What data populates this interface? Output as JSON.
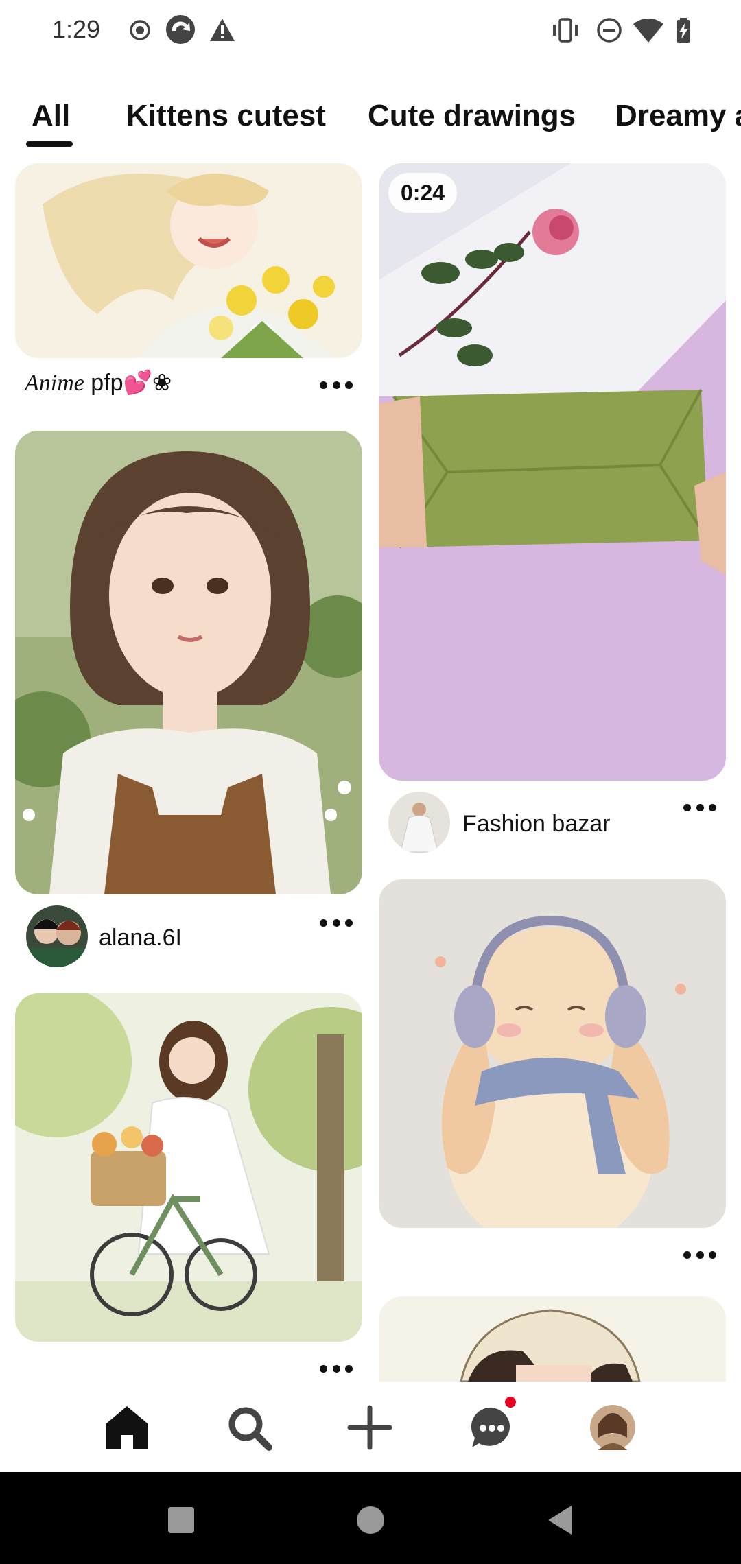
{
  "status_bar": {
    "time": "1:29",
    "left_icons": [
      "record-icon",
      "sync-app-icon",
      "warning-icon"
    ],
    "right_icons": [
      "vibrate-icon",
      "do-not-disturb-icon",
      "wifi-icon",
      "battery-charging-icon"
    ]
  },
  "tabs": [
    {
      "label": "All",
      "selected": true
    },
    {
      "label": "Kittens cutest",
      "selected": false
    },
    {
      "label": "Cute drawings",
      "selected": false
    },
    {
      "label": "Dreamy a",
      "selected": false
    }
  ],
  "feed": {
    "left_column": [
      {
        "image": "anime girl with yellow tulips",
        "caption_italic": "Anime",
        "caption_rest": " pfp💕❀",
        "has_more": true
      },
      {
        "image": "girl with bob haircut in garden",
        "author": "alana.6I",
        "has_more": true
      },
      {
        "image": "girl riding bicycle in forest",
        "has_more": true
      }
    ],
    "right_column": [
      {
        "image": "folding green paper envelope with rose",
        "video_duration": "0:24",
        "author": "Fashion bazar",
        "has_more": true
      },
      {
        "image": "bunny with headphones and scarf",
        "has_more": true
      },
      {
        "image": "drawing of girl with hat",
        "has_more": false
      }
    ]
  },
  "bottom_nav": {
    "items": [
      "home-icon",
      "search-icon",
      "create-icon",
      "messages-icon",
      "profile-avatar"
    ],
    "active": "home-icon",
    "messages_has_notification": true
  },
  "colors": {
    "accent_red": "#e60023",
    "text": "#111111",
    "background": "#ffffff"
  }
}
